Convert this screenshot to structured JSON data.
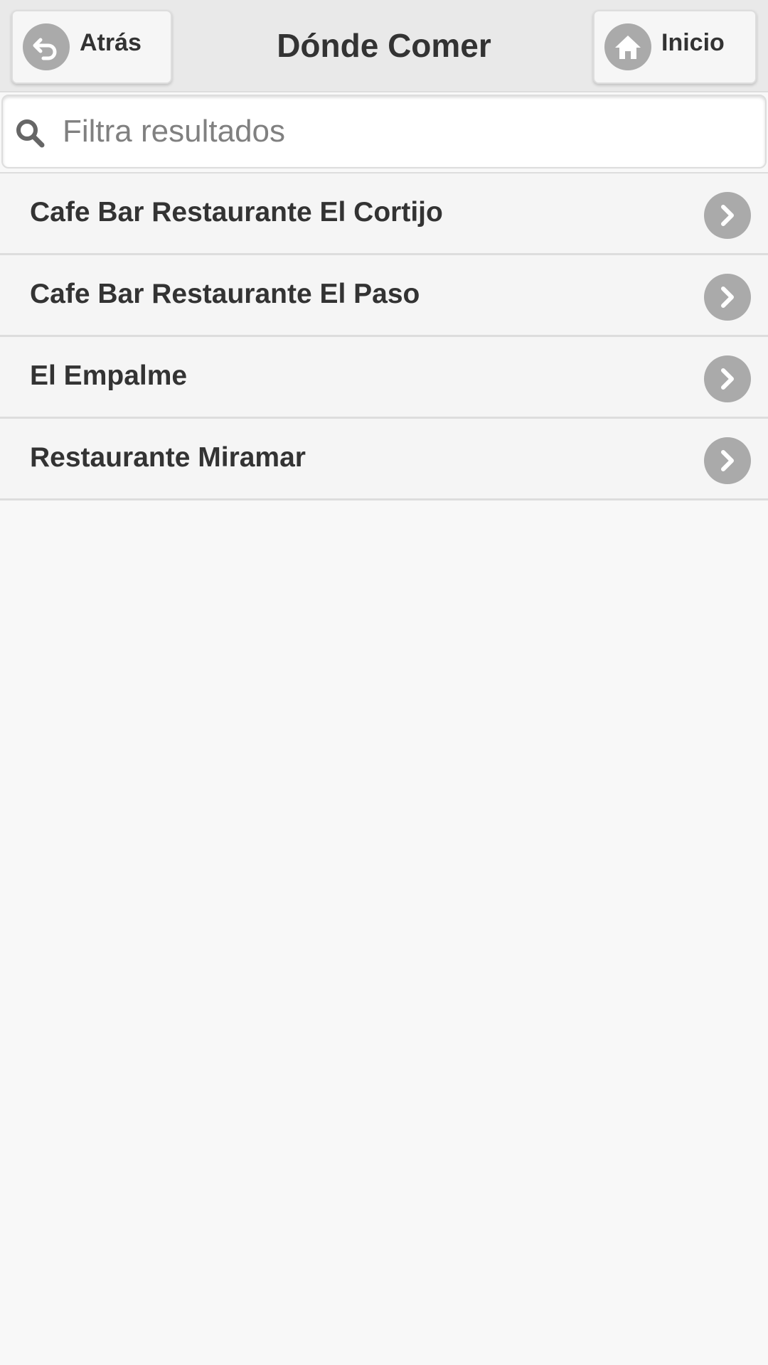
{
  "header": {
    "back_label": "Atrás",
    "title": "Dónde Comer",
    "home_label": "Inicio",
    "back_icon": "undo-arrow-icon",
    "home_icon": "home-icon"
  },
  "search": {
    "placeholder": "Filtra resultados",
    "value": "",
    "icon": "search-icon"
  },
  "list": {
    "items": [
      {
        "label": "Cafe Bar Restaurante El Cortijo"
      },
      {
        "label": "Cafe Bar Restaurante El Paso"
      },
      {
        "label": "El Empalme"
      },
      {
        "label": "Restaurante Miramar"
      }
    ],
    "item_icon": "chevron-right-icon"
  },
  "colors": {
    "header_bg": "#e9e9e9",
    "icon_circle": "#aaaaaa",
    "text": "#333333",
    "page_bg": "#f8f8f8"
  }
}
